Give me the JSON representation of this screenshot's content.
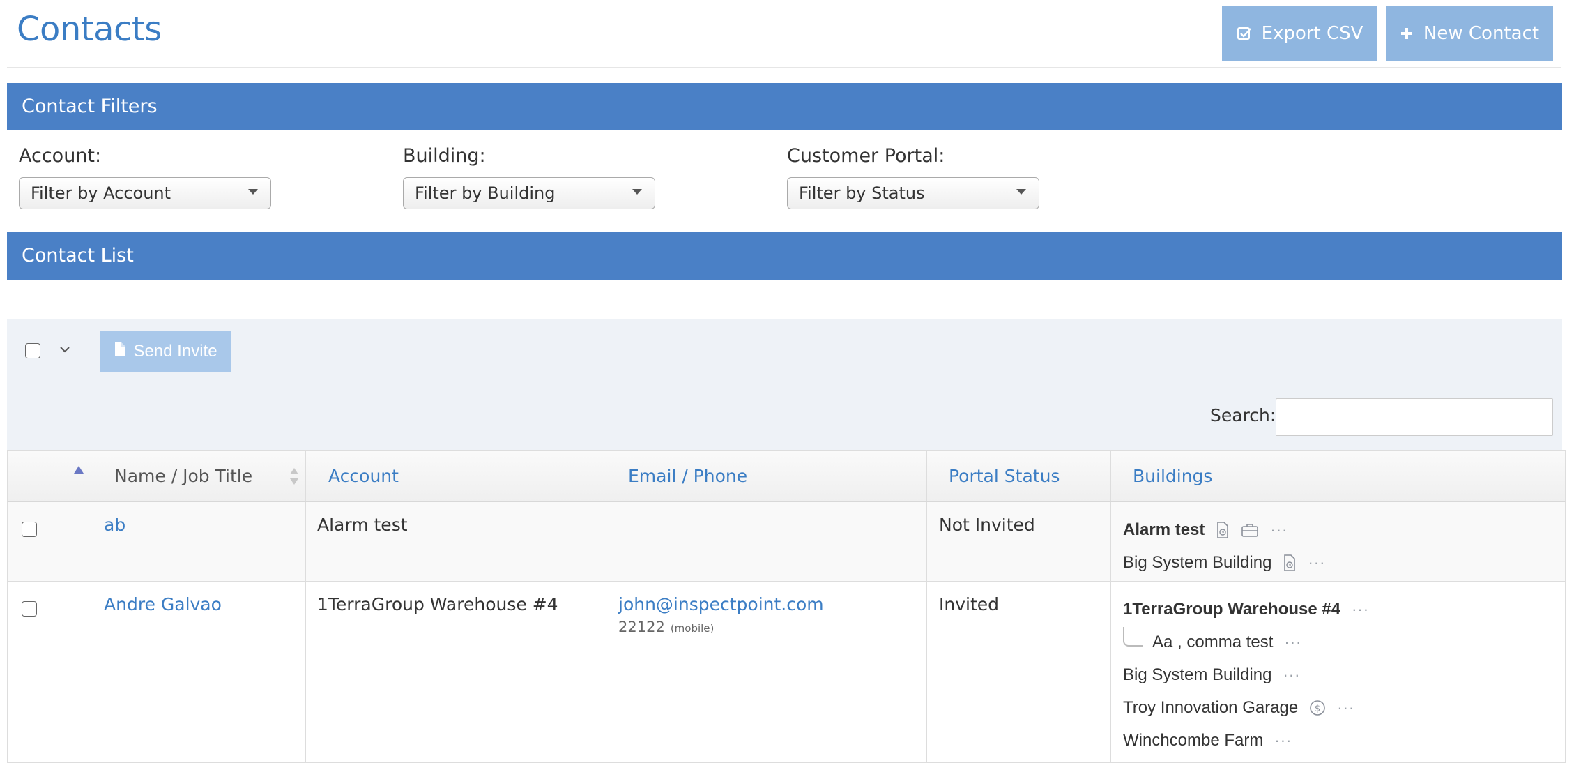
{
  "header": {
    "title": "Contacts",
    "export_label": "Export CSV",
    "new_contact_label": "New Contact"
  },
  "filters_section": {
    "title": "Contact Filters",
    "account": {
      "label": "Account:",
      "value": "Filter by Account"
    },
    "building": {
      "label": "Building:",
      "value": "Filter by Building"
    },
    "portal": {
      "label": "Customer Portal:",
      "value": "Filter by Status"
    }
  },
  "list_section": {
    "title": "Contact List",
    "send_invite_label": "Send Invite",
    "search_label": "Search:",
    "search_value": ""
  },
  "table": {
    "columns": {
      "name": "Name / Job Title",
      "account": "Account",
      "email": "Email / Phone",
      "portal": "Portal Status",
      "buildings": "Buildings"
    },
    "rows": [
      {
        "name": "ab",
        "account": "Alarm test",
        "email": "",
        "phone": "",
        "phone_type": "",
        "portal_status": "Not Invited",
        "buildings": [
          {
            "name": "Alarm test",
            "primary": true,
            "icons": [
              "document-clock-icon",
              "briefcase-icon"
            ]
          },
          {
            "name": "Big System Building",
            "primary": false,
            "icons": [
              "document-clock-icon"
            ]
          }
        ]
      },
      {
        "name": "Andre Galvao",
        "account": "1TerraGroup Warehouse #4",
        "email": "john@inspectpoint.com",
        "phone": "22122",
        "phone_type": "(mobile)",
        "portal_status": "Invited",
        "buildings": [
          {
            "name": "1TerraGroup Warehouse #4",
            "primary": true,
            "icons": []
          },
          {
            "name": "Aa , comma test",
            "primary": false,
            "child": true,
            "icons": []
          },
          {
            "name": "Big System Building",
            "primary": false,
            "icons": []
          },
          {
            "name": "Troy Innovation Garage",
            "primary": false,
            "icons": [
              "dollar-circle-icon"
            ]
          },
          {
            "name": "Winchcombe Farm",
            "primary": false,
            "icons": []
          }
        ]
      }
    ]
  },
  "colors": {
    "brand_blue": "#4a80c6",
    "link_blue": "#3b7dc4",
    "button_light_blue": "#8fb6e0",
    "toolbar_bg": "#eef2f7"
  }
}
